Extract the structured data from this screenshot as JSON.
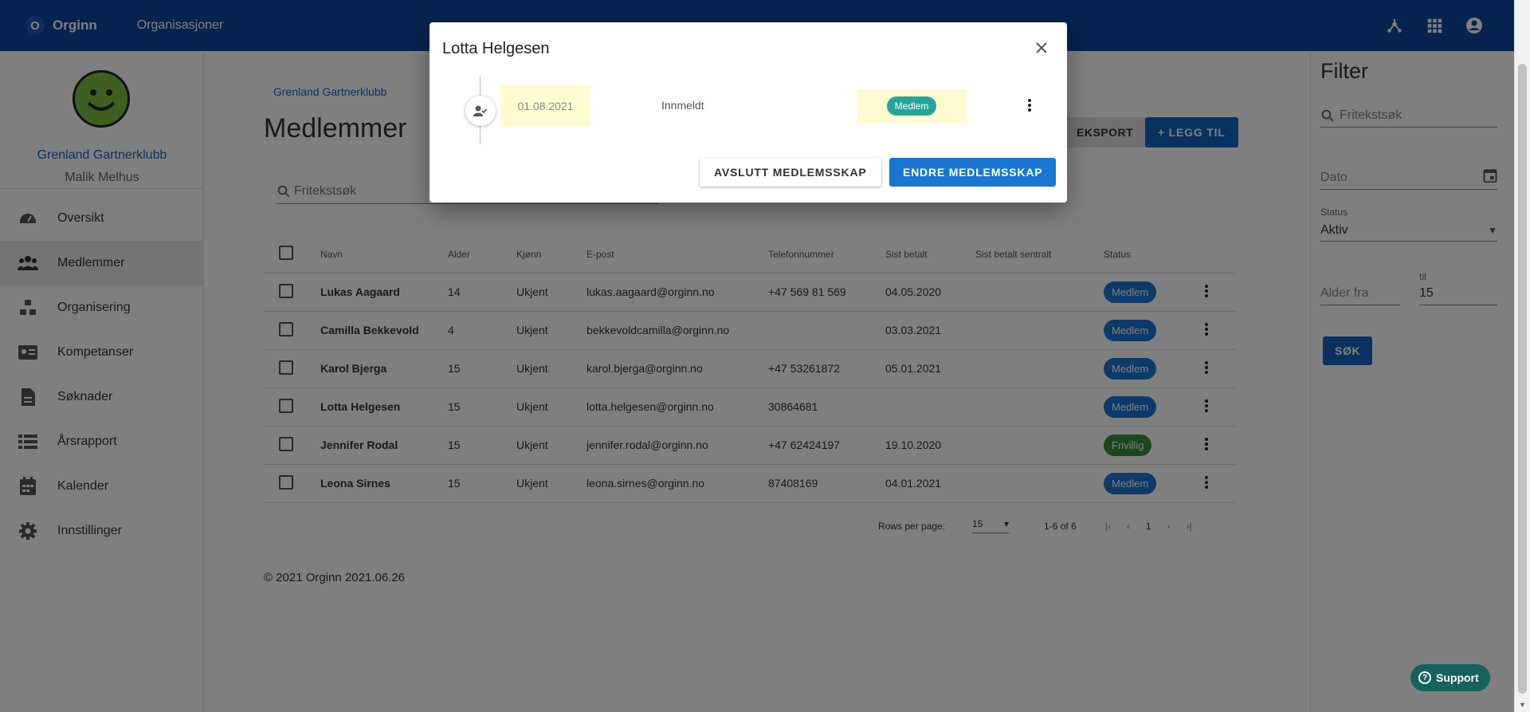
{
  "app": {
    "name": "Orginn",
    "logo_letter": "O",
    "nav_link": "Organisasjoner"
  },
  "sidebar": {
    "club_name": "Grenland Gartnerklubb",
    "user_name": "Malik Melhus",
    "items": [
      {
        "label": "Oversikt",
        "icon": "dashboard-icon"
      },
      {
        "label": "Medlemmer",
        "icon": "people-icon",
        "active": true
      },
      {
        "label": "Organisering",
        "icon": "organization-icon"
      },
      {
        "label": "Kompetanser",
        "icon": "id-card-icon"
      },
      {
        "label": "Søknader",
        "icon": "document-icon"
      },
      {
        "label": "Årsrapport",
        "icon": "list-icon"
      },
      {
        "label": "Kalender",
        "icon": "calendar-icon"
      },
      {
        "label": "Innstillinger",
        "icon": "gear-icon"
      }
    ]
  },
  "main": {
    "breadcrumb": "Grenland Gartnerklubb",
    "title": "Medlemmer",
    "export_label": "EKSPORT",
    "add_label": "LEGG TIL",
    "search_placeholder": "Fritekstsøk",
    "columns": [
      "Navn",
      "Alder",
      "Kjønn",
      "E-post",
      "Telefonnummer",
      "Sist betalt",
      "Sist betalt sentralt",
      "Status"
    ],
    "rows": [
      {
        "name": "Lukas Aagaard",
        "age": "14",
        "gender": "Ukjent",
        "email": "lukas.aagaard@orginn.no",
        "phone": "+47 569 81 569",
        "last_paid": "04.05.2020",
        "last_paid_central": "",
        "status": "Medlem"
      },
      {
        "name": "Camilla Bekkevold",
        "age": "4",
        "gender": "Ukjent",
        "email": "bekkevoldcamilla@orginn.no",
        "phone": "",
        "last_paid": "03.03.2021",
        "last_paid_central": "",
        "status": "Medlem"
      },
      {
        "name": "Karol Bjerga",
        "age": "15",
        "gender": "Ukjent",
        "email": "karol.bjerga@orginn.no",
        "phone": "+47 53261872",
        "last_paid": "05.01.2021",
        "last_paid_central": "",
        "status": "Medlem"
      },
      {
        "name": "Lotta Helgesen",
        "age": "15",
        "gender": "Ukjent",
        "email": "lotta.helgesen@orginn.no",
        "phone": "30864681",
        "last_paid": "",
        "last_paid_central": "",
        "status": "Medlem"
      },
      {
        "name": "Jennifer Rodal",
        "age": "15",
        "gender": "Ukjent",
        "email": "jennifer.rodal@orginn.no",
        "phone": "+47 62424197",
        "last_paid": "19.10.2020",
        "last_paid_central": "",
        "status": "Frivillig"
      },
      {
        "name": "Leona Sirnes",
        "age": "15",
        "gender": "Ukjent",
        "email": "leona.sirnes@orginn.no",
        "phone": "87408169",
        "last_paid": "04.01.2021",
        "last_paid_central": "",
        "status": "Medlem"
      }
    ],
    "pagination": {
      "rows_label": "Rows per page:",
      "rows_value": "15",
      "range": "1-6 of 6",
      "page": "1"
    },
    "footer": "© 2021 Orginn 2021.06.26"
  },
  "filter": {
    "title": "Filter",
    "search_placeholder": "Fritekstsøk",
    "date_placeholder": "Dato",
    "status_label": "Status",
    "status_value": "Aktiv",
    "age_from_placeholder": "Alder fra",
    "age_to_label": "til",
    "age_to_value": "15",
    "button": "SØK"
  },
  "dialog": {
    "title": "Lotta Helgesen",
    "entry": {
      "date": "01.08.2021",
      "action": "Innmeldt",
      "status": "Medlem"
    },
    "end_button": "AVSLUTT MEDLEMSSKAP",
    "change_button": "ENDRE MEDLEMSSKAP"
  },
  "support": {
    "label": "Support"
  },
  "colors": {
    "primary": "#0d47a1",
    "button_blue": "#1565c0",
    "badge_member": "#1976d2",
    "badge_volunteer": "#388e3c",
    "badge_dialog": "#26a69a",
    "highlight": "#fffbd0"
  }
}
